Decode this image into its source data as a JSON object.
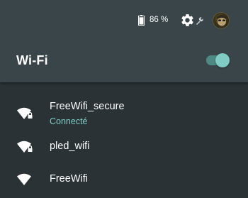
{
  "status_bar": {
    "battery_text": "86 %",
    "battery_level": 0.86,
    "icons": [
      "battery-icon",
      "gear-icon",
      "wrench-icon",
      "avatar"
    ]
  },
  "wifi": {
    "title": "Wi-Fi",
    "enabled": true,
    "accent_color": "#80cbc4"
  },
  "networks": [
    {
      "name": "FreeWifi_secure",
      "status": "Connecté",
      "secured": true,
      "icon": "wifi-locked-icon"
    },
    {
      "name": "pled_wifi",
      "status": "",
      "secured": true,
      "icon": "wifi-locked-icon"
    },
    {
      "name": "FreeWifi",
      "status": "",
      "secured": false,
      "icon": "wifi-icon"
    }
  ]
}
